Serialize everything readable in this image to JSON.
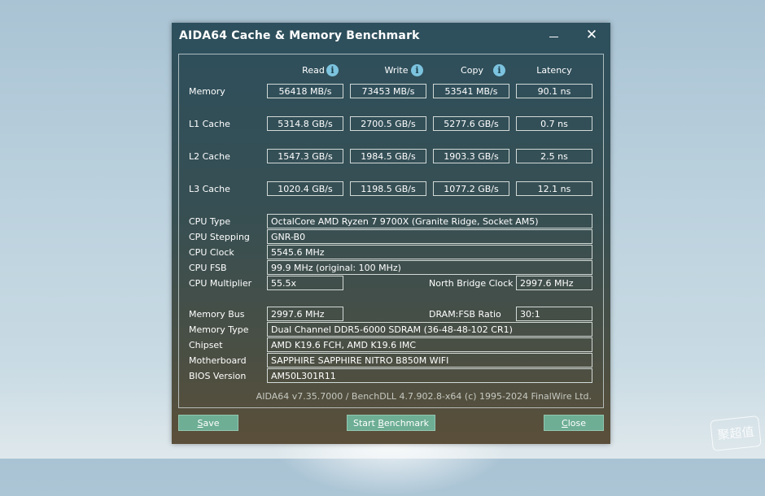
{
  "window": {
    "title": "AIDA64 Cache & Memory Benchmark"
  },
  "columns": {
    "read": "Read",
    "write": "Write",
    "copy": "Copy",
    "latency": "Latency"
  },
  "rows": [
    {
      "label": "Memory",
      "read": "56418 MB/s",
      "write": "73453 MB/s",
      "copy": "53541 MB/s",
      "latency": "90.1 ns"
    },
    {
      "label": "L1 Cache",
      "read": "5314.8 GB/s",
      "write": "2700.5 GB/s",
      "copy": "5277.6 GB/s",
      "latency": "0.7 ns"
    },
    {
      "label": "L2 Cache",
      "read": "1547.3 GB/s",
      "write": "1984.5 GB/s",
      "copy": "1903.3 GB/s",
      "latency": "2.5 ns"
    },
    {
      "label": "L3 Cache",
      "read": "1020.4 GB/s",
      "write": "1198.5 GB/s",
      "copy": "1077.2 GB/s",
      "latency": "12.1 ns"
    }
  ],
  "cpu": {
    "type_label": "CPU Type",
    "type": "OctalCore AMD Ryzen 7 9700X  (Granite Ridge, Socket AM5)",
    "stepping_label": "CPU Stepping",
    "stepping": "GNR-B0",
    "clock_label": "CPU Clock",
    "clock": "5545.6 MHz",
    "fsb_label": "CPU FSB",
    "fsb": "99.9 MHz  (original: 100 MHz)",
    "multiplier_label": "CPU Multiplier",
    "multiplier": "55.5x",
    "nb_clock_label": "North Bridge Clock",
    "nb_clock": "2997.6 MHz"
  },
  "memory": {
    "bus_label": "Memory Bus",
    "bus": "2997.6 MHz",
    "ratio_label": "DRAM:FSB Ratio",
    "ratio": "30:1",
    "type_label": "Memory Type",
    "type": "Dual Channel DDR5-6000 SDRAM  (36-48-48-102 CR1)",
    "chipset_label": "Chipset",
    "chipset": "AMD K19.6 FCH, AMD K19.6 IMC",
    "motherboard_label": "Motherboard",
    "motherboard": "SAPPHIRE SAPPHIRE NITRO B850M WIFI",
    "bios_label": "BIOS Version",
    "bios": "AM50L301R11"
  },
  "footer": {
    "version": "AIDA64 v7.35.7000 / BenchDLL 4.7.902.8-x64  (c) 1995-2024 FinalWire Ltd."
  },
  "buttons": {
    "save_first": "S",
    "save_rest": "ave",
    "start_first": "Start ",
    "start_u": "B",
    "start_rest": "enchmark",
    "close_first": "C",
    "close_rest": "lose"
  },
  "icons": {
    "info": "info-icon",
    "minimize": "minimize-icon",
    "close": "close-icon"
  },
  "watermark": "聚超值"
}
